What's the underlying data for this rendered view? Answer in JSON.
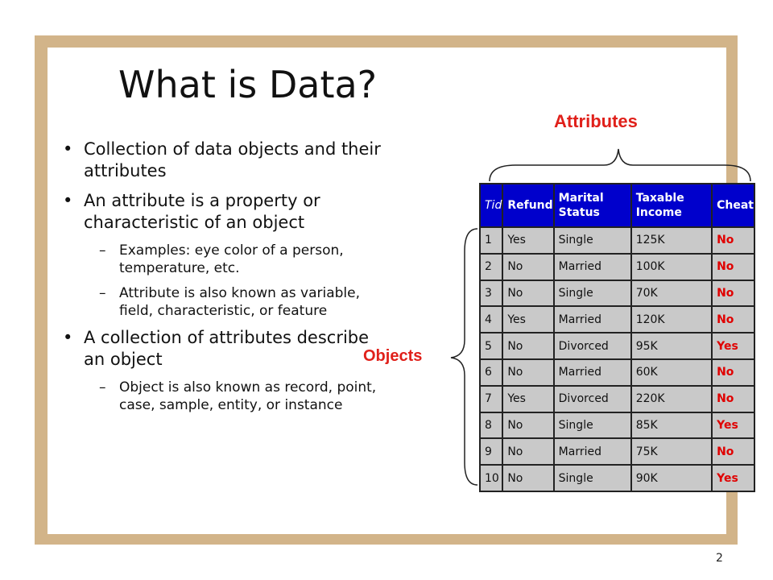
{
  "slide": {
    "title": "What is Data?",
    "page_number": "2",
    "bullets": [
      {
        "level": 1,
        "text": "Collection of data objects and their attributes"
      },
      {
        "level": 1,
        "text": "An attribute is a property or characteristic of an object"
      },
      {
        "level": 2,
        "text": "Examples: eye color of a person, temperature, etc."
      },
      {
        "level": 2,
        "text": "Attribute is also known as variable, field, characteristic, or feature"
      },
      {
        "level": 1,
        "text": "A collection of attributes describe an object"
      },
      {
        "level": 2,
        "text": "Object is also known as record, point, case, sample, entity, or instance"
      }
    ],
    "bullet_symbol": "•",
    "dash_symbol": "–",
    "labels": {
      "attributes": "Attributes",
      "objects": "Objects"
    }
  },
  "table": {
    "headers": [
      {
        "key": "tid",
        "text": "Tid"
      },
      {
        "key": "refund",
        "text": "Refund"
      },
      {
        "key": "marital",
        "text": "Marital Status"
      },
      {
        "key": "income",
        "text": "Taxable Income"
      },
      {
        "key": "cheat",
        "text": "Cheat"
      }
    ],
    "rows": [
      [
        "1",
        "Yes",
        "Single",
        "125K",
        "No"
      ],
      [
        "2",
        "No",
        "Married",
        "100K",
        "No"
      ],
      [
        "3",
        "No",
        "Single",
        "70K",
        "No"
      ],
      [
        "4",
        "Yes",
        "Married",
        "120K",
        "No"
      ],
      [
        "5",
        "No",
        "Divorced",
        "95K",
        "Yes"
      ],
      [
        "6",
        "No",
        "Married",
        "60K",
        "No"
      ],
      [
        "7",
        "Yes",
        "Divorced",
        "220K",
        "No"
      ],
      [
        "8",
        "No",
        "Single",
        "85K",
        "Yes"
      ],
      [
        "9",
        "No",
        "Married",
        "75K",
        "No"
      ],
      [
        "10",
        "No",
        "Single",
        "90K",
        "Yes"
      ]
    ]
  },
  "colors": {
    "header_bg": "#0000cc",
    "cell_bg": "#c9c9c9",
    "highlight": "#e0201a",
    "frame": "#d2b489"
  }
}
